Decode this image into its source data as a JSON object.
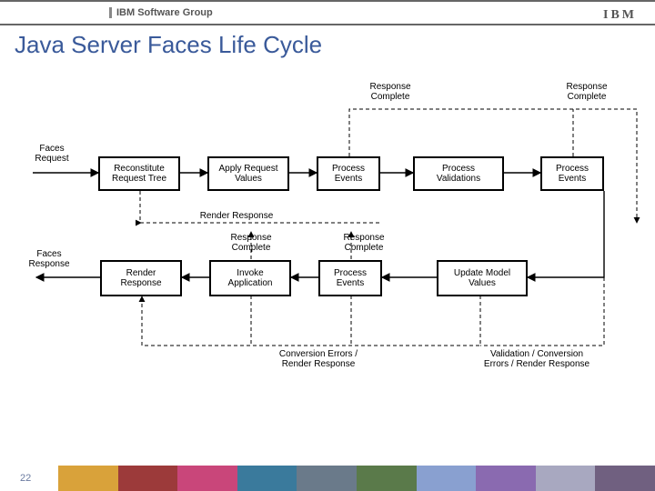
{
  "header": {
    "group": "IBM Software Group",
    "logo": "IBM"
  },
  "title": "Java Server Faces Life Cycle",
  "page_number": "22",
  "diagram": {
    "inputs": {
      "request": "Faces\nRequest",
      "response": "Faces\nResponse"
    },
    "top_row": [
      "Reconstitute\nRequest Tree",
      "Apply Request\nValues",
      "Process\nEvents",
      "Process\nValidations",
      "Process\nEvents"
    ],
    "bottom_row": [
      "Render\nResponse",
      "Invoke\nApplication",
      "Process\nEvents",
      "Update Model\nValues"
    ],
    "labels": {
      "resp_complete_tr1": "Response\nComplete",
      "resp_complete_tr2": "Response\nComplete",
      "render_response_mid": "Render Response",
      "resp_complete_br1": "Response\nComplete",
      "resp_complete_br2": "Response\nComplete",
      "conv_err": "Conversion Errors /\nRender Response",
      "val_conv_err": "Validation / Conversion\nErrors / Render Response"
    }
  },
  "footer_colors": [
    "#d9a23a",
    "#9c3a3a",
    "#c9467a",
    "#3a7a9c",
    "#6a7a8a",
    "#5a7a4a",
    "#89a0d0",
    "#8a6ab0",
    "#a8a8c0",
    "#706080"
  ]
}
